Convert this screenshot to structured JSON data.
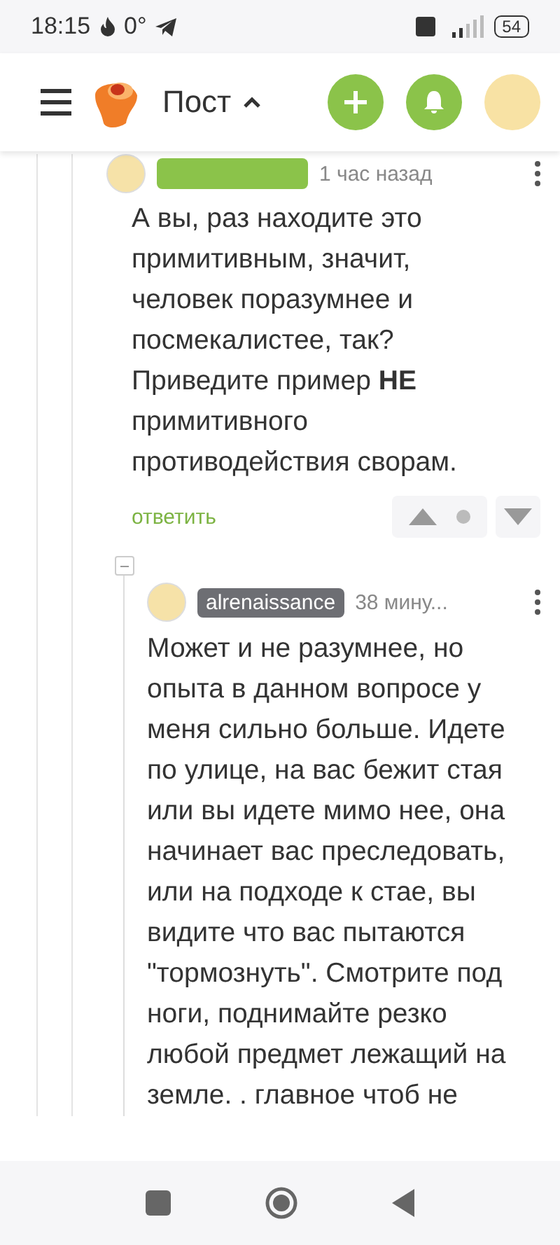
{
  "status_bar": {
    "time": "18:15",
    "temperature": "0°",
    "battery": "54"
  },
  "header": {
    "title": "Пост",
    "expanded": true
  },
  "comments": [
    {
      "time": "1 час назад",
      "text": "А вы, раз находите это примитивным, значит, человек поразумнее и посмекалистее, так? Приведите пример **НЕ** примитивного противодействия сворам.",
      "reply": "ответить",
      "color": "#8bc34a"
    },
    {
      "user": "alrenaissance",
      "time": "38 мину...",
      "text": "Может и не разумнее, но опыта в данном вопросе у меня сильно больше. Идете по улице, на вас бежит стая или вы идете мимо нее, она начинает вас преследовать, или на подходе к стае, вы видите что вас пытаются \"тормознуть\". Смотрите под ноги, поднимайте резко любой предмет лежащий на земле. . главное чтоб не",
      "color": "#6d6e73"
    }
  ]
}
